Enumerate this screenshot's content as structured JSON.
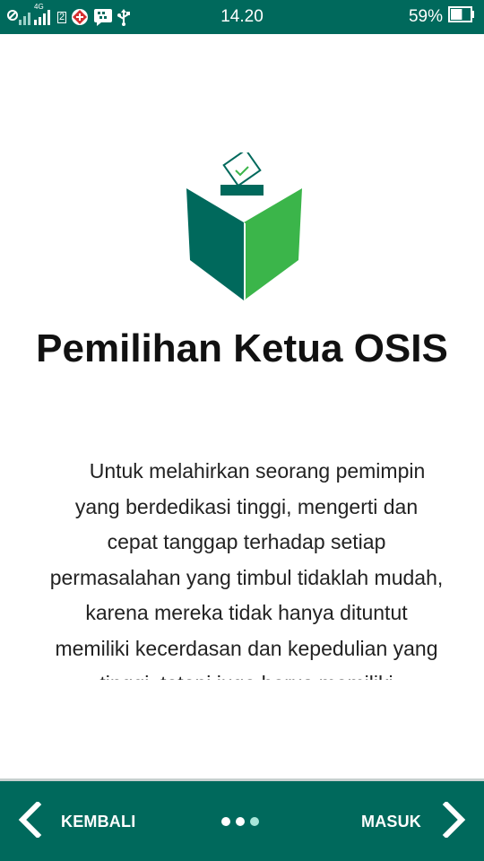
{
  "status_bar": {
    "network_label": "4G",
    "sim_label": "2",
    "time": "14.20",
    "battery_percent_text": "59%",
    "battery_level": 0.59
  },
  "main": {
    "title": "Pemilihan Ketua OSIS",
    "description": "Untuk melahirkan seorang pemimpin yang berdedikasi tinggi, mengerti dan cepat tanggap terhadap setiap permasalahan yang timbul tidaklah mudah, karena mereka tidak hanya dituntut memiliki kecerdasan dan kepedulian yang tinggi, tetapi juga harus memiliki kemampuan untuk memimpin."
  },
  "bottom_bar": {
    "back_label": "KEMBALI",
    "next_label": "MASUK",
    "pages": 3,
    "active_page": 3
  },
  "colors": {
    "primary": "#00695c",
    "logo_dark": "#00695c",
    "logo_light": "#3bb54a"
  }
}
